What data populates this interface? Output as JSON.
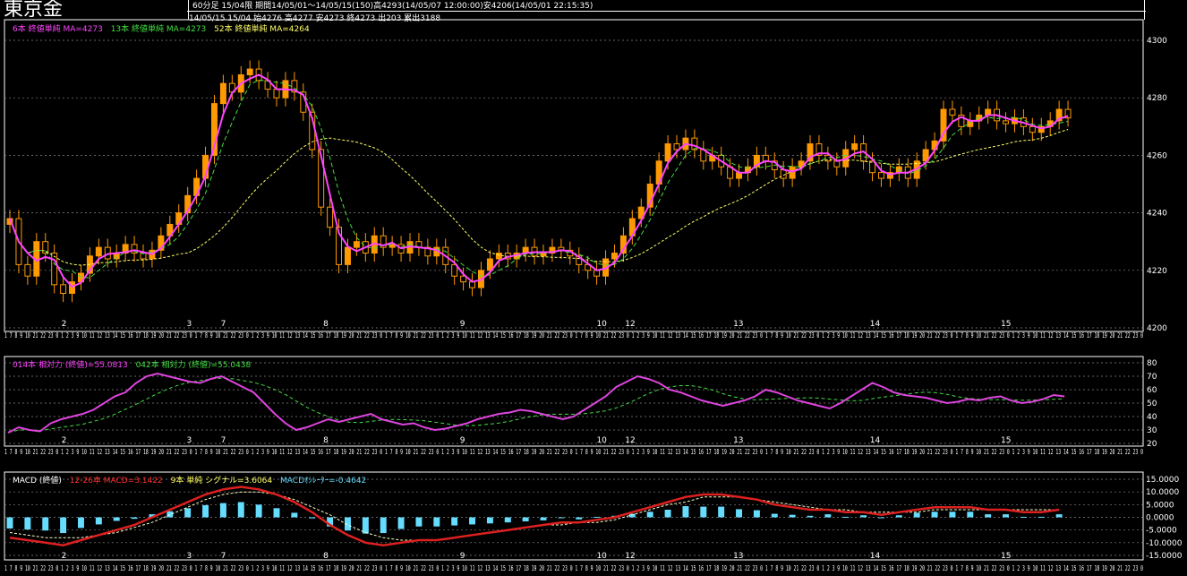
{
  "title": "東京金",
  "header": {
    "line1": "60分足 15/04限  期間14/05/01～14/05/15(150)高4293(14/05/07 12:00:00)安4206(14/05/01 22:15:35)",
    "line2": "14/05/15 15/04 始4276 高4277 安4273 終4273 出203 累出3188"
  },
  "price_legend": [
    {
      "text": "6本 終値単純 MA=4273",
      "color": "#ff44ff"
    },
    {
      "text": "13本 終値単純 MA=4273",
      "color": "#44dd44"
    },
    {
      "text": "52本 終値単純 MA=4264",
      "color": "#ffff66"
    }
  ],
  "rsi_legend": [
    {
      "text": "014本 相対力 (終値)=55.0813",
      "color": "#ff44ff"
    },
    {
      "text": "042本 相対力 (終値)=55.0438",
      "color": "#44dd44"
    }
  ],
  "macd_legend": [
    {
      "text": "MACD (終値)",
      "color": "#ffffff"
    },
    {
      "text": "12-26本 MACD=3.1422",
      "color": "#ff3030"
    },
    {
      "text": "9本 単純 シグナル=3.6064",
      "color": "#ffff66"
    },
    {
      "text": "MACDｵｼﾚｰﾀｰ=-0.4642",
      "color": "#66ddff"
    }
  ],
  "day_labels": [
    "2",
    "3",
    "7",
    "8",
    "9",
    "10",
    "12",
    "13",
    "14",
    "15"
  ],
  "hour_ticks": "1 7 8 9 10 21 22 23 0 1 2 3 9 10 11 12 13 14 15 16 17 18 19 20 21 22 23 0",
  "chart_data": [
    {
      "type": "candlestick",
      "title": "東京金 60分足",
      "ylim": [
        4200,
        4300
      ],
      "yticks": [
        "4200",
        "4220",
        "4240",
        "4260",
        "4280",
        "4300"
      ],
      "close": [
        4238,
        4222,
        4218,
        4230,
        4226,
        4215,
        4212,
        4216,
        4219,
        4225,
        4228,
        4224,
        4226,
        4229,
        4226,
        4224,
        4227,
        4232,
        4236,
        4240,
        4246,
        4252,
        4260,
        4278,
        4285,
        4282,
        4288,
        4290,
        4286,
        4283,
        4280,
        4286,
        4282,
        4275,
        4262,
        4242,
        4235,
        4222,
        4228,
        4230,
        4226,
        4232,
        4228,
        4229,
        4226,
        4230,
        4228,
        4225,
        4228,
        4222,
        4218,
        4216,
        4214,
        4220,
        4224,
        4226,
        4224,
        4226,
        4228,
        4225,
        4226,
        4228,
        4227,
        4225,
        4222,
        4220,
        4218,
        4224,
        4226,
        4232,
        4238,
        4242,
        4250,
        4258,
        4264,
        4262,
        4266,
        4262,
        4258,
        4260,
        4256,
        4252,
        4254,
        4256,
        4260,
        4258,
        4255,
        4252,
        4256,
        4258,
        4264,
        4260,
        4258,
        4256,
        4262,
        4264,
        4258,
        4254,
        4252,
        4254,
        4256,
        4252,
        4258,
        4262,
        4265,
        4276,
        4274,
        4270,
        4272,
        4274,
        4276,
        4272,
        4271,
        4273,
        4270,
        4268,
        4270,
        4272,
        4276,
        4273
      ],
      "rsi": [
        28,
        32,
        30,
        29,
        35,
        38,
        40,
        42,
        45,
        50,
        55,
        58,
        65,
        70,
        72,
        70,
        68,
        66,
        65,
        68,
        70,
        66,
        62,
        58,
        50,
        42,
        35,
        30,
        32,
        35,
        38,
        36,
        38,
        40,
        42,
        38,
        36,
        34,
        35,
        32,
        30,
        31,
        33,
        35,
        38,
        40,
        42,
        43,
        45,
        44,
        42,
        40,
        38,
        40,
        45,
        50,
        55,
        62,
        66,
        70,
        68,
        65,
        60,
        58,
        55,
        52,
        50,
        48,
        50,
        52,
        55,
        60,
        58,
        55,
        52,
        50,
        48,
        46,
        50,
        55,
        60,
        65,
        62,
        58,
        56,
        55,
        54,
        52,
        50,
        51,
        53,
        52,
        54,
        55,
        52,
        50,
        51,
        53,
        56,
        55
      ],
      "macd": [
        -8,
        -9,
        -10,
        -11,
        -9,
        -7,
        -5,
        -3,
        0,
        3,
        6,
        9,
        11,
        12,
        11,
        9,
        6,
        2,
        -3,
        -7,
        -10,
        -11,
        -10,
        -9,
        -9,
        -8,
        -7,
        -6,
        -5,
        -4,
        -3,
        -2,
        -2,
        -1,
        0,
        2,
        4,
        6,
        8,
        9,
        9,
        8,
        7,
        5,
        4,
        3,
        3,
        2,
        2,
        1,
        2,
        3,
        4,
        4,
        4,
        3,
        3,
        2,
        2,
        3
      ],
      "signal": [
        -6,
        -7,
        -8,
        -8,
        -8,
        -7,
        -6,
        -4,
        -2,
        1,
        4,
        7,
        9,
        10,
        10,
        9,
        7,
        4,
        1,
        -3,
        -6,
        -8,
        -9,
        -9,
        -9,
        -8,
        -7,
        -6,
        -5,
        -4,
        -3,
        -3,
        -2,
        -2,
        -1,
        1,
        3,
        5,
        6,
        8,
        8,
        8,
        7,
        6,
        5,
        4,
        3,
        3,
        2,
        2,
        2,
        2,
        3,
        3,
        3,
        3,
        3,
        3,
        3,
        3
      ]
    }
  ]
}
